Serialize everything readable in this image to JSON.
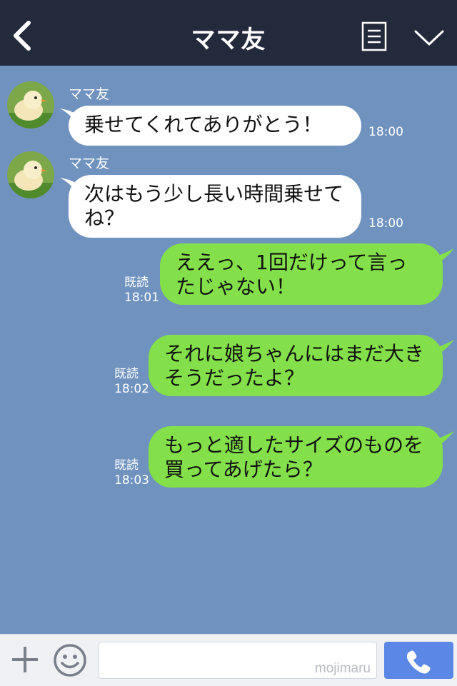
{
  "header": {
    "title": "ママ友",
    "bg": "#232a3b"
  },
  "messages": [
    {
      "direction": "incoming",
      "sender": "ママ友",
      "text": "乗せてくれてありがとう！",
      "time": "18:00"
    },
    {
      "direction": "incoming",
      "sender": "ママ友",
      "text": "次はもう少し長い時間乗せてね？",
      "time": "18:00"
    },
    {
      "direction": "outgoing",
      "read": "既読",
      "text": "ええっ、1回だけって言ったじゃない！",
      "time": "18:01"
    },
    {
      "direction": "outgoing",
      "read": "既読",
      "text": "それに娘ちゃんにはまだ大きそうだったよ？",
      "time": "18:02"
    },
    {
      "direction": "outgoing",
      "read": "既読",
      "text": "もっと適したサイズのものを買ってあげたら？",
      "time": "18:03"
    }
  ],
  "composer": {
    "placeholder": "",
    "watermark": "mojimaru"
  },
  "icons": {
    "back": "chevron-left-icon",
    "notes": "notes-icon",
    "menu": "chevron-down-icon",
    "plus": "plus-icon",
    "emoji": "smiley-icon",
    "call": "phone-icon"
  },
  "colors": {
    "chat_bg": "#7092be",
    "incoming_bubble": "#ffffff",
    "outgoing_bubble": "#84e04a",
    "call_button": "#5b88e6"
  }
}
